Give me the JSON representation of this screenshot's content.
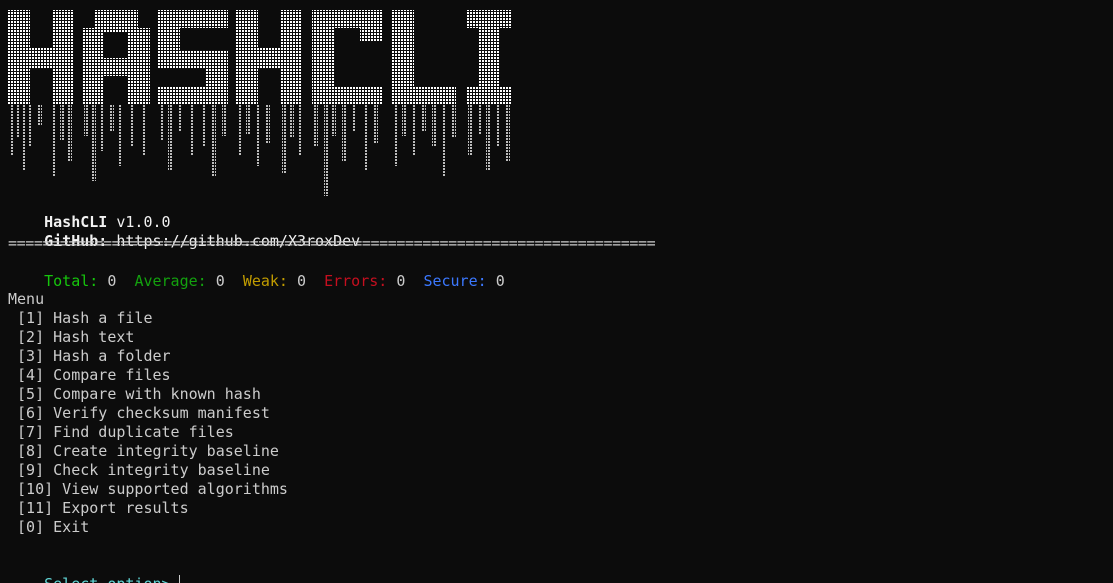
{
  "banner": {
    "text": "HASHCLI"
  },
  "header": {
    "version_name": "HashCLI",
    "version": "v1.0.0",
    "github_label": "GitHub:",
    "github_url": "https://github.com/X3roxDev",
    "rule": "==========================================================================="
  },
  "stats": {
    "total_label": "Total:",
    "total_value": "0",
    "average_label": "Average:",
    "average_value": "0",
    "weak_label": "Weak:",
    "weak_value": "0",
    "errors_label": "Errors:",
    "errors_value": "0",
    "secure_label": "Secure:",
    "secure_value": "0"
  },
  "menu": {
    "title": "Menu",
    "items": [
      " [1] Hash a file",
      " [2] Hash text",
      " [3] Hash a folder",
      " [4] Compare files",
      " [5] Compare with known hash",
      " [6] Verify checksum manifest",
      " [7] Find duplicate files",
      " [8] Create integrity baseline",
      " [9] Check integrity baseline",
      " [10] View supported algorithms",
      " [11] Export results",
      " [0] Exit"
    ]
  },
  "prompt": {
    "label": "Select option>",
    "value": ""
  },
  "colors": {
    "background": "#0c0c0c",
    "text": "#cccccc",
    "total": "#16c60c",
    "average": "#13a10e",
    "weak": "#c19c00",
    "errors": "#c50f1f",
    "secure": "#3b78ff",
    "prompt": "#61d6d6"
  }
}
